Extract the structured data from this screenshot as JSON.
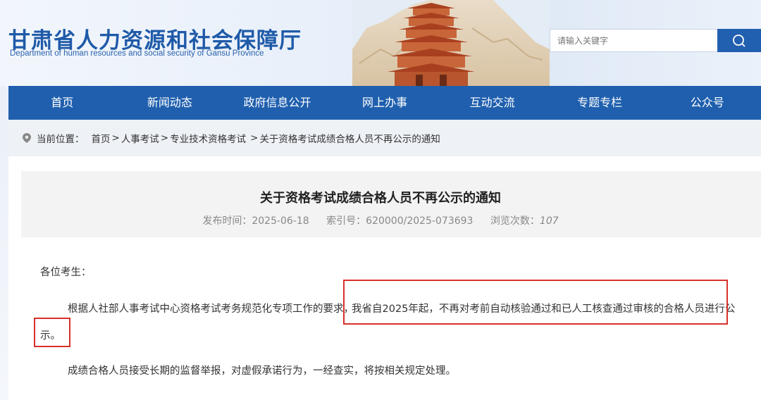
{
  "header": {
    "logo_cn": "甘肃省人力资源和社会保障厅",
    "logo_en": "Department of human resources and social security of Gansu Province",
    "search_placeholder": "请输入关键字",
    "search_icon": "search-icon"
  },
  "nav": {
    "items": [
      "首页",
      "新闻动态",
      "政府信息公开",
      "网上办事",
      "互动交流",
      "专题专栏",
      "公众号"
    ]
  },
  "breadcrumb": {
    "label": "当前位置：",
    "items": [
      "首页",
      "人事考试",
      "专业技术资格考试",
      "关于资格考试成绩合格人员不再公示的通知"
    ],
    "separator": ">"
  },
  "article": {
    "title": "关于资格考试成绩合格人员不再公示的通知",
    "publish_label": "发布时间：",
    "publish_date": "2025-06-18",
    "index_label": "索引号：",
    "index_no": "620000/2025-073693",
    "views_label": "浏览次数：",
    "views": "107",
    "salutation": "各位考生：",
    "para1_start": "根据人社部人事考试中心资格考试考务规范化专项工作的要求，",
    "para1_highlight": "我省自2025年起，不再对考前自动核验通过和已人工核查通过审核的合格人员进行公",
    "para1_end": "示。",
    "para2": "成绩合格人员接受长期的监督举报，对虚假承诺行为，一经查实，将按相关规定处理。"
  },
  "colors": {
    "brand_blue": "#1f5fae",
    "highlight_red": "#d8312c"
  }
}
